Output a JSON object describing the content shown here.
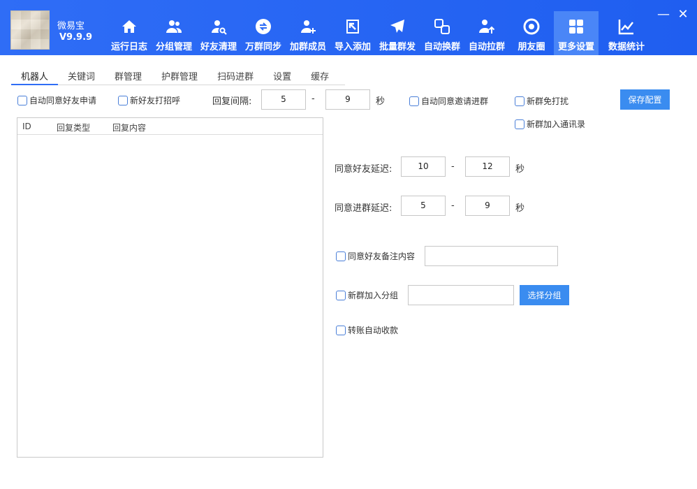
{
  "app": {
    "name": "微易宝",
    "version": "V9.9.9"
  },
  "nav": [
    {
      "label": "运行日志",
      "icon": "home-icon"
    },
    {
      "label": "分组管理",
      "icon": "users-icon"
    },
    {
      "label": "好友清理",
      "icon": "user-search-icon"
    },
    {
      "label": "万群同步",
      "icon": "sync-icon"
    },
    {
      "label": "加群成员",
      "icon": "user-add-icon"
    },
    {
      "label": "导入添加",
      "icon": "import-icon"
    },
    {
      "label": "批量群发",
      "icon": "send-icon"
    },
    {
      "label": "自动换群",
      "icon": "swap-icon"
    },
    {
      "label": "自动拉群",
      "icon": "user-up-icon"
    },
    {
      "label": "朋友圈",
      "icon": "aperture-icon"
    },
    {
      "label": "更多设置",
      "icon": "grid-icon"
    },
    {
      "label": "数据统计",
      "icon": "chart-icon"
    }
  ],
  "window": {
    "minimize": "—",
    "close": "✕"
  },
  "tabs": [
    "机器人",
    "关键词",
    "群管理",
    "护群管理",
    "扫码进群",
    "设置",
    "缓存"
  ],
  "options": {
    "auto_accept_friend": "自动同意好友申请",
    "greet_new_friend": "新好友打招呼",
    "reply_interval_label": "回复间隔:",
    "reply_min": "5",
    "reply_max": "9",
    "dash": "-",
    "seconds": "秒",
    "auto_accept_group_invite": "自动同意邀请进群",
    "new_group_no_disturb": "新群免打扰",
    "new_group_contacts": "新群加入通讯录",
    "save_button": "保存配置"
  },
  "table": {
    "columns": [
      "ID",
      "回复类型",
      "回复内容"
    ],
    "rows": []
  },
  "delays": {
    "friend_label": "同意好友延迟:",
    "friend_min": "10",
    "friend_max": "12",
    "group_label": "同意进群延迟:",
    "group_min": "5",
    "group_max": "9"
  },
  "extra": {
    "friend_remark": "同意好友备注内容",
    "friend_remark_value": "",
    "group_add_to": "新群加入分组",
    "group_value": "",
    "choose_group_button": "选择分组",
    "auto_receive_transfer": "转账自动收款"
  }
}
